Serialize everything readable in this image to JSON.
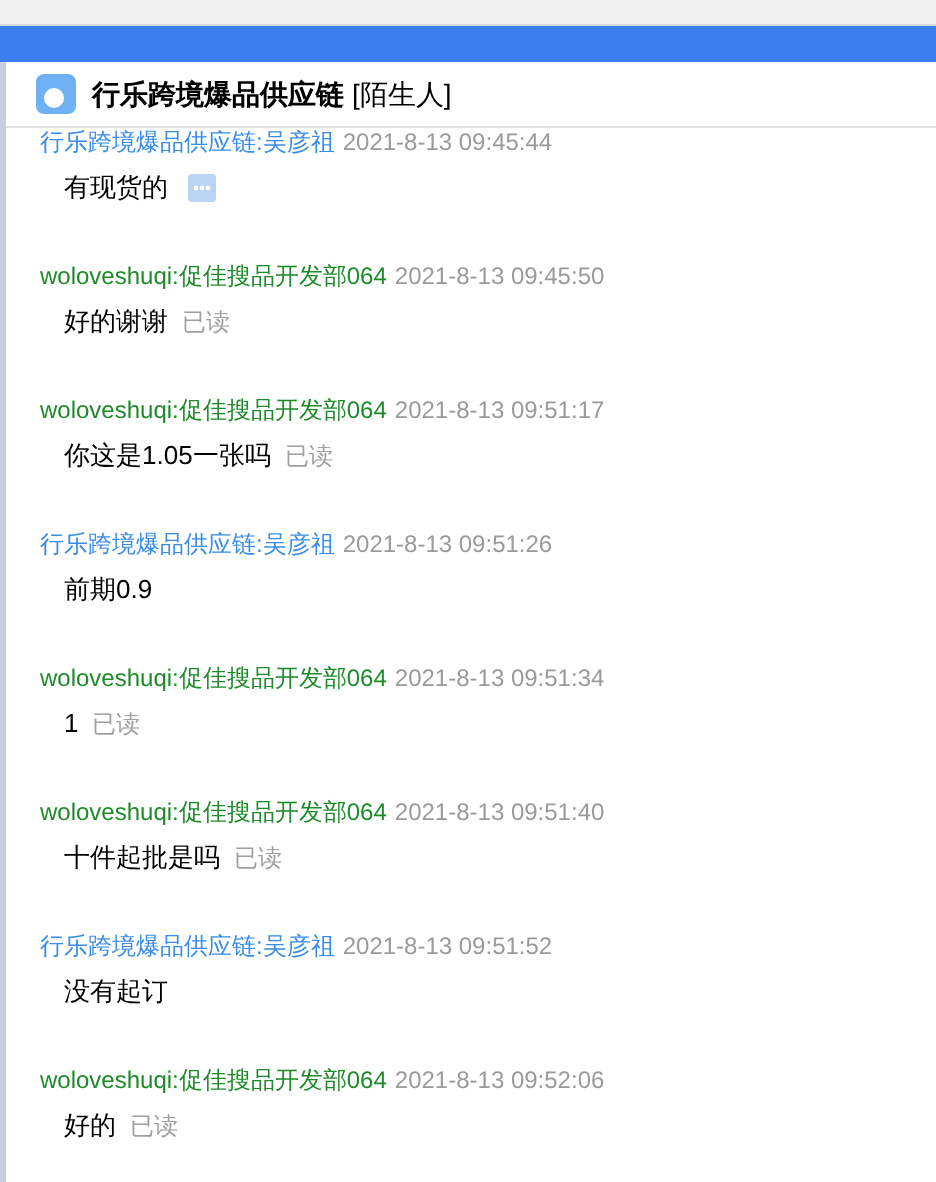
{
  "chat": {
    "title": "行乐跨境爆品供应链",
    "tag": "[陌生人]"
  },
  "messages": [
    {
      "kind": "peer",
      "sender": "行乐跨境爆品供应链:吴彦祖",
      "time": "2021-8-13 09:45:44",
      "text": "有现货的",
      "more": true
    },
    {
      "kind": "self",
      "sender": "woloveshuqi:促佳搜品开发部064",
      "time": "2021-8-13 09:45:50",
      "text": "好的谢谢",
      "receipt": "已读"
    },
    {
      "kind": "self",
      "sender": "woloveshuqi:促佳搜品开发部064",
      "time": "2021-8-13 09:51:17",
      "text": "你这是1.05一张吗",
      "receipt": "已读"
    },
    {
      "kind": "peer",
      "sender": "行乐跨境爆品供应链:吴彦祖",
      "time": "2021-8-13 09:51:26",
      "text": "前期0.9"
    },
    {
      "kind": "self",
      "sender": "woloveshuqi:促佳搜品开发部064",
      "time": "2021-8-13 09:51:34",
      "text": "1",
      "receipt": "已读"
    },
    {
      "kind": "self",
      "sender": "woloveshuqi:促佳搜品开发部064",
      "time": "2021-8-13 09:51:40",
      "text": "十件起批是吗",
      "receipt": "已读"
    },
    {
      "kind": "peer",
      "sender": "行乐跨境爆品供应链:吴彦祖",
      "time": "2021-8-13 09:51:52",
      "text": "没有起订"
    },
    {
      "kind": "self",
      "sender": "woloveshuqi:促佳搜品开发部064",
      "time": "2021-8-13 09:52:06",
      "text": "好的",
      "receipt": "已读"
    }
  ]
}
